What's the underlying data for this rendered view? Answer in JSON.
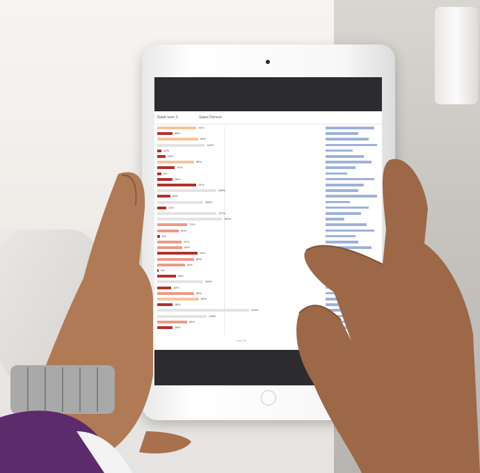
{
  "toolbar": {
    "rank_label": "Rank over 3",
    "sort_label": "Sales Person"
  },
  "axis_title": "Sales ($)",
  "bar_labels": [
    "91%",
    "35%",
    "95%",
    "110%",
    "10%",
    "19%",
    "85%",
    "41%",
    "9%",
    "36%",
    "91%",
    "136%",
    "30%",
    "106%",
    "21%",
    "137%",
    "150%",
    "70%",
    "50%",
    "6%",
    "57%",
    "58%",
    "94%",
    "85%",
    "64%",
    "3%",
    "43%",
    "106%",
    "33%",
    "85%",
    "96%",
    "36%",
    "213%",
    "115%",
    "69%",
    "36%"
  ],
  "colors": {
    "dark_red": "#b3302a",
    "salmon": "#eb9a87",
    "peach": "#f6c49a",
    "grey": "#e3e3e3",
    "blue": "#9db2d9"
  }
}
